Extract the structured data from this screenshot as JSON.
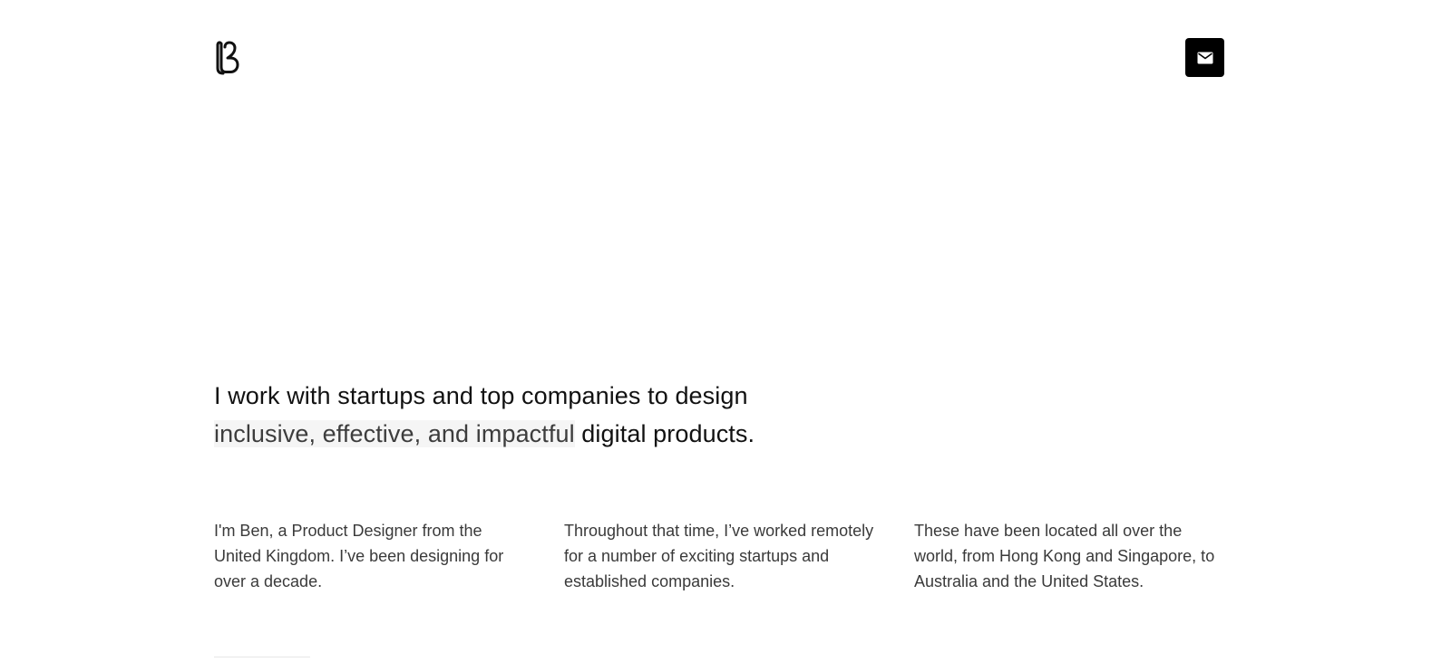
{
  "header": {
    "logo_icon": "b-monogram-logo",
    "contact_icon": "envelope-icon",
    "contact_button_color": "#000000"
  },
  "hero": {
    "line1": "I work with startups and top companies to design",
    "highlight": "inclusive, effective, and impactful",
    "line2_rest": " digital products."
  },
  "intro": {
    "col1": "I'm Ben, a Product Designer from the United Kingdom. I’ve been designing for over a decade.",
    "col2": "Throughout that time, I’ve worked remotely for a number of exciting startups and established companies.",
    "col3": "These have been located all over the world, from Hong Kong and Singapore, to Australia and the United States."
  }
}
